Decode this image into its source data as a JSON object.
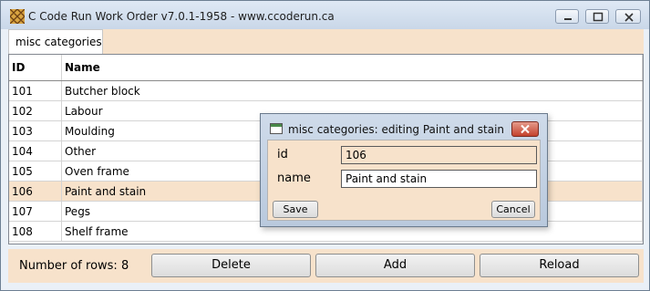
{
  "window": {
    "title": "C Code Run Work Order v7.0.1-1958 - www.ccoderun.ca",
    "icon": "app-pattern-icon"
  },
  "tabs": [
    {
      "label": "misc categories"
    }
  ],
  "table": {
    "columns": [
      "ID",
      "Name"
    ],
    "rows": [
      {
        "id": "101",
        "name": "Butcher block"
      },
      {
        "id": "102",
        "name": "Labour"
      },
      {
        "id": "103",
        "name": "Moulding"
      },
      {
        "id": "104",
        "name": "Other"
      },
      {
        "id": "105",
        "name": "Oven frame"
      },
      {
        "id": "106",
        "name": "Paint and stain",
        "selected": true
      },
      {
        "id": "107",
        "name": "Pegs"
      },
      {
        "id": "108",
        "name": "Shelf frame"
      }
    ]
  },
  "footer": {
    "row_count_label": "Number of rows: 8",
    "delete_label": "Delete",
    "add_label": "Add",
    "reload_label": "Reload"
  },
  "dialog": {
    "title": "misc categories: editing Paint and stain",
    "id_label": "id",
    "id_value": "106",
    "name_label": "name",
    "name_value": "Paint and stain",
    "save_label": "Save",
    "cancel_label": "Cancel"
  },
  "colors": {
    "accent": "#f7e2cb",
    "selected_row": "#f7e2cb",
    "close_button": "#c4422d"
  }
}
